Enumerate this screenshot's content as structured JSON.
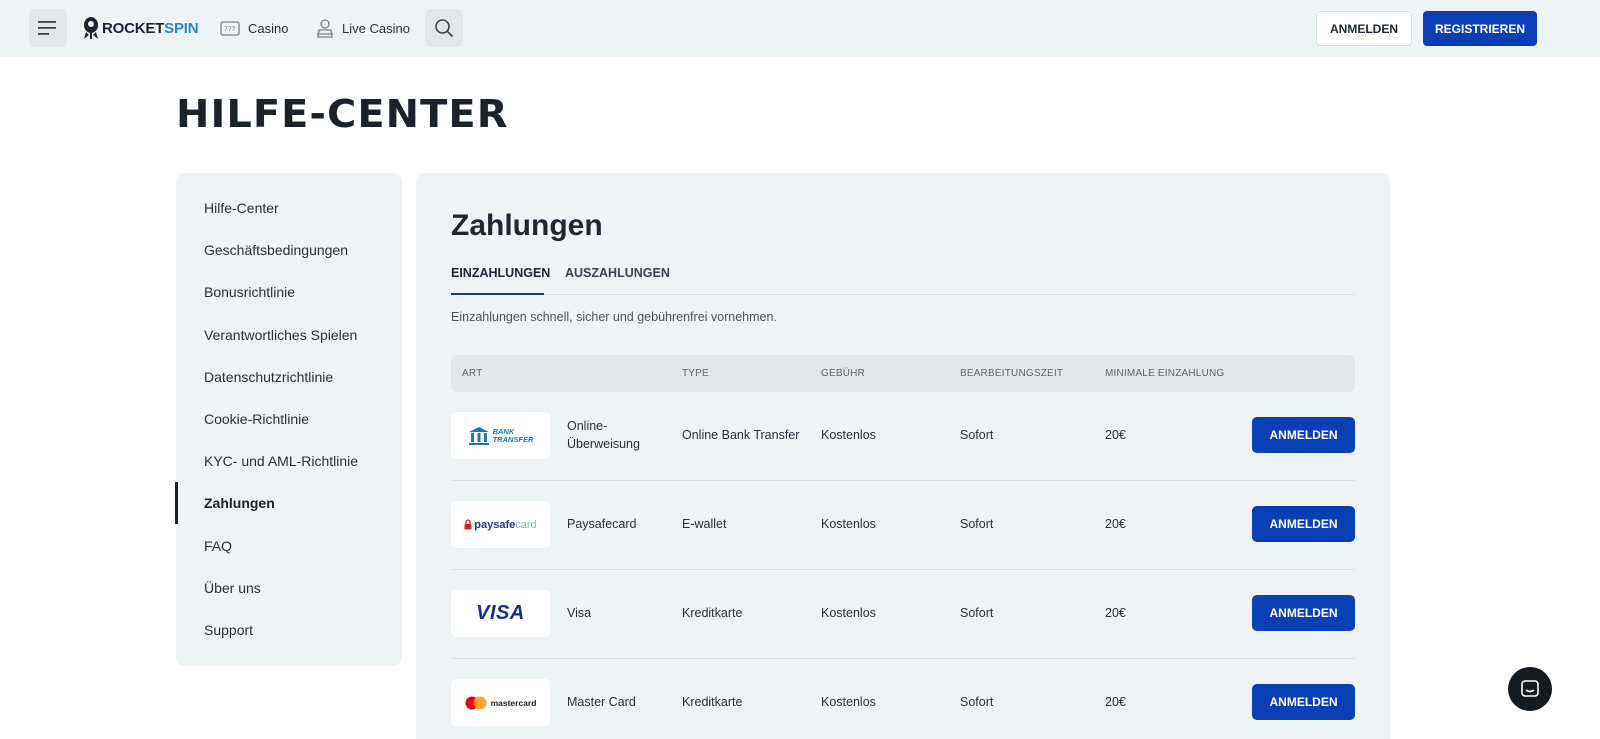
{
  "header": {
    "logo": {
      "part1": "ROCKET",
      "part2": "SPIN"
    },
    "nav": [
      {
        "label": "Casino",
        "icon": "slot-machine-icon"
      },
      {
        "label": "Live Casino",
        "icon": "dealer-icon"
      }
    ],
    "login_label": "ANMELDEN",
    "register_label": "REGISTRIEREN"
  },
  "page_title": "HILFE-CENTER",
  "sidebar": {
    "items": [
      {
        "label": "Hilfe-Center"
      },
      {
        "label": "Geschäftsbedingungen"
      },
      {
        "label": "Bonusrichtlinie"
      },
      {
        "label": "Verantwortliches Spielen"
      },
      {
        "label": "Datenschutzrichtlinie"
      },
      {
        "label": "Cookie-Richtlinie"
      },
      {
        "label": "KYC- und AML-Richtlinie"
      },
      {
        "label": "Zahlungen",
        "active": true
      },
      {
        "label": "FAQ"
      },
      {
        "label": "Über uns"
      },
      {
        "label": "Support"
      }
    ]
  },
  "main": {
    "title": "Zahlungen",
    "tabs": [
      {
        "label": "EINZAHLUNGEN",
        "active": true
      },
      {
        "label": "AUSZAHLUNGEN"
      }
    ],
    "intro": "Einzahlungen schnell, sicher und gebührenfrei vornehmen.",
    "table": {
      "headers": [
        "ART",
        "TYPE",
        "GEBÜHR",
        "BEARBEITUNGSZEIT",
        "MINIMALE EINZAHLUNG"
      ],
      "rows": [
        {
          "name_line1": "Online-",
          "name_line2": "Überweisung",
          "logo": "bank-transfer-logo",
          "logo_text_1": "BANK",
          "logo_text_2": "TRANSFER",
          "type": "Online Bank Transfer",
          "fee": "Kostenlos",
          "time": "Sofort",
          "min": "20€",
          "button": "ANMELDEN"
        },
        {
          "name": "Paysafecard",
          "logo": "paysafecard-logo",
          "logo_text_1": "paysafe",
          "logo_text_2": "card",
          "type": "E-wallet",
          "fee": "Kostenlos",
          "time": "Sofort",
          "min": "20€",
          "button": "ANMELDEN"
        },
        {
          "name": "Visa",
          "logo": "visa-logo",
          "logo_text_1": "VISA",
          "type": "Kreditkarte",
          "fee": "Kostenlos",
          "time": "Sofort",
          "min": "20€",
          "button": "ANMELDEN"
        },
        {
          "name": "Master Card",
          "logo": "mastercard-logo",
          "logo_text_1": "mastercard",
          "type": "Kreditkarte",
          "fee": "Kostenlos",
          "time": "Sofort",
          "min": "20€",
          "button": "ANMELDEN"
        }
      ]
    }
  },
  "colors": {
    "primary": "#0b3fb5",
    "panel_bg": "#eef3f6",
    "brand_accent": "#2a86c6"
  },
  "chat_icon": "chat-icon"
}
